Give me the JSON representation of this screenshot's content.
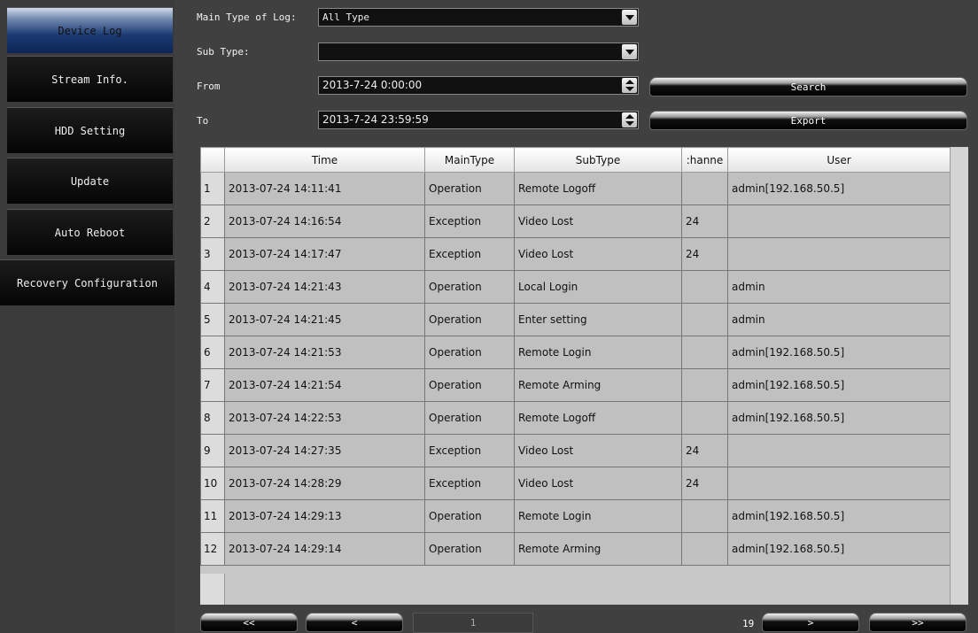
{
  "sidebar": {
    "items": [
      {
        "label": "Device Log"
      },
      {
        "label": "Stream Info."
      },
      {
        "label": "HDD Setting"
      },
      {
        "label": "Update"
      },
      {
        "label": "Auto Reboot"
      },
      {
        "label": "Recovery Configuration"
      }
    ]
  },
  "filters": {
    "main_type_label": "Main Type of Log:",
    "main_type_value": "All Type",
    "sub_type_label": "Sub Type:",
    "sub_type_value": "",
    "from_label": "From",
    "from_value": "2013-7-24 0:00:00",
    "to_label": "To",
    "to_value": "2013-7-24 23:59:59",
    "search_label": "Search",
    "export_label": "Export"
  },
  "table": {
    "headers": [
      "Time",
      "MainType",
      "SubType",
      ":hanne",
      "User"
    ],
    "rows": [
      {
        "n": "1",
        "time": "2013-07-24 14:11:41",
        "main": "Operation",
        "sub": "Remote Logoff",
        "ch": "",
        "user": "admin[192.168.50.5]"
      },
      {
        "n": "2",
        "time": "2013-07-24 14:16:54",
        "main": "Exception",
        "sub": "Video Lost",
        "ch": "24",
        "user": ""
      },
      {
        "n": "3",
        "time": "2013-07-24 14:17:47",
        "main": "Exception",
        "sub": "Video Lost",
        "ch": "24",
        "user": ""
      },
      {
        "n": "4",
        "time": "2013-07-24 14:21:43",
        "main": "Operation",
        "sub": "Local Login",
        "ch": "",
        "user": "admin"
      },
      {
        "n": "5",
        "time": "2013-07-24 14:21:45",
        "main": "Operation",
        "sub": "Enter setting",
        "ch": "",
        "user": "admin"
      },
      {
        "n": "6",
        "time": "2013-07-24 14:21:53",
        "main": "Operation",
        "sub": "Remote Login",
        "ch": "",
        "user": "admin[192.168.50.5]"
      },
      {
        "n": "7",
        "time": "2013-07-24 14:21:54",
        "main": "Operation",
        "sub": "Remote Arming",
        "ch": "",
        "user": "admin[192.168.50.5]"
      },
      {
        "n": "8",
        "time": "2013-07-24 14:22:53",
        "main": "Operation",
        "sub": "Remote Logoff",
        "ch": "",
        "user": "admin[192.168.50.5]"
      },
      {
        "n": "9",
        "time": "2013-07-24 14:27:35",
        "main": "Exception",
        "sub": "Video Lost",
        "ch": "24",
        "user": ""
      },
      {
        "n": "10",
        "time": "2013-07-24 14:28:29",
        "main": "Exception",
        "sub": "Video Lost",
        "ch": "24",
        "user": ""
      },
      {
        "n": "11",
        "time": "2013-07-24 14:29:13",
        "main": "Operation",
        "sub": "Remote Login",
        "ch": "",
        "user": "admin[192.168.50.5]"
      },
      {
        "n": "12",
        "time": "2013-07-24 14:29:14",
        "main": "Operation",
        "sub": "Remote Arming",
        "ch": "",
        "user": "admin[192.168.50.5]"
      }
    ]
  },
  "pager": {
    "first": "<<",
    "prev": "<",
    "current": "1",
    "total": "19",
    "next": ">",
    "last": ">>"
  }
}
